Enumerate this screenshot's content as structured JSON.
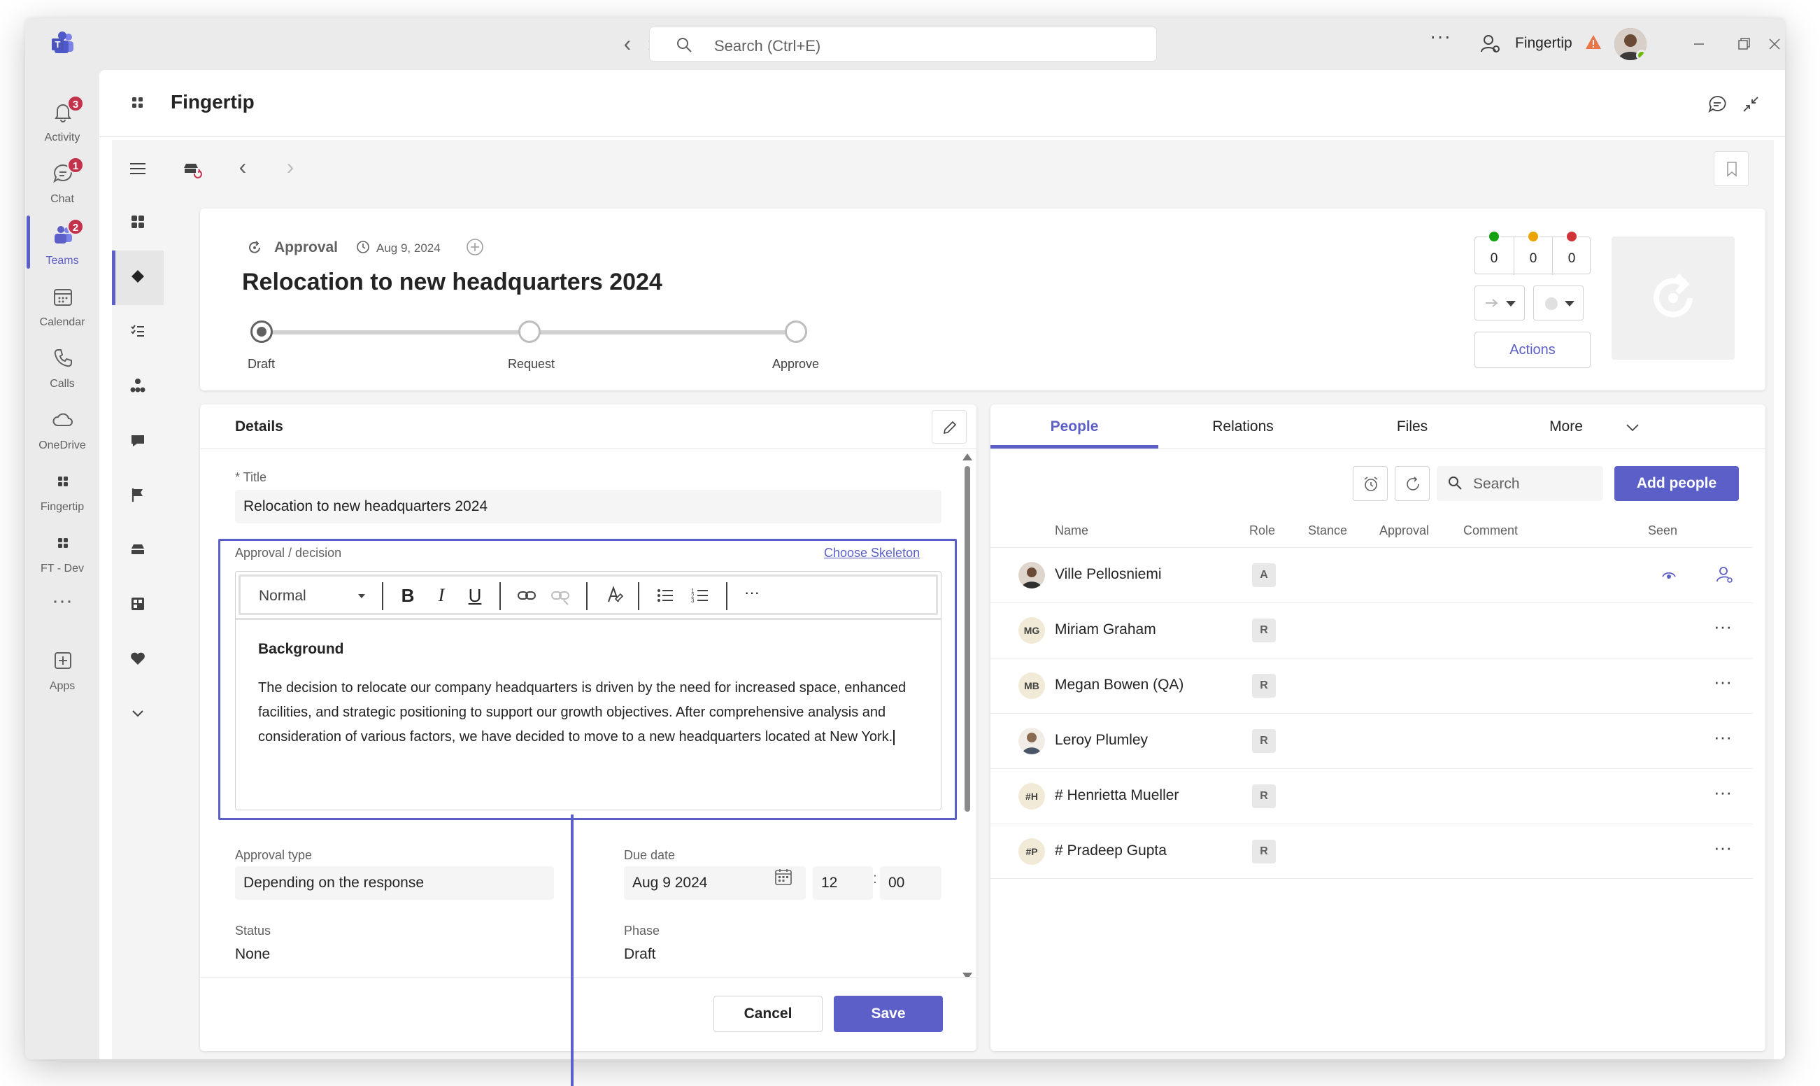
{
  "titlebar": {
    "search_placeholder": "Search (Ctrl+E)",
    "more": "···",
    "org_name": "Fingertip"
  },
  "rail": {
    "items": [
      {
        "label": "Activity",
        "badge": "3",
        "icon": "bell-icon"
      },
      {
        "label": "Chat",
        "badge": "1",
        "icon": "chat-icon"
      },
      {
        "label": "Teams",
        "badge": "2",
        "icon": "teams-icon",
        "active": true
      },
      {
        "label": "Calendar",
        "icon": "calendar-icon"
      },
      {
        "label": "Calls",
        "icon": "phone-icon"
      },
      {
        "label": "OneDrive",
        "icon": "cloud-icon"
      },
      {
        "label": "Fingertip",
        "icon": "app-grid-icon"
      },
      {
        "label": "FT - Dev",
        "icon": "app-grid-icon"
      },
      {
        "label": "Apps",
        "icon": "add-app-icon"
      }
    ],
    "more": "···"
  },
  "app": {
    "title": "Fingertip"
  },
  "record": {
    "type": "Approval",
    "date": "Aug 9, 2024",
    "title": "Relocation to new headquarters 2024",
    "phases": [
      {
        "label": "Draft",
        "current": true
      },
      {
        "label": "Request"
      },
      {
        "label": "Approve"
      }
    ],
    "counters": [
      {
        "value": "0",
        "color": "#13a10e"
      },
      {
        "value": "0",
        "color": "#eaa300"
      },
      {
        "value": "0",
        "color": "#d13438"
      }
    ],
    "actions_label": "Actions"
  },
  "details": {
    "heading": "Details",
    "title_label": "Title",
    "title_required": "*",
    "title_value": "Relocation to new headquarters 2024",
    "decision_label": "Approval / decision",
    "choose_skeleton": "Choose Skeleton",
    "editor": {
      "style": "Normal",
      "more": "···",
      "heading": "Background",
      "paragraph": "The decision to relocate our company headquarters is driven by the need for increased space, enhanced facilities, and strategic positioning to support our growth objectives. After comprehensive analysis and consideration of various factors, we have decided to move to a new headquarters located at New York."
    },
    "approval_type_label": "Approval type",
    "approval_type_value": "Depending on the response",
    "due_date_label": "Due date",
    "due_date_value": "Aug 9 2024",
    "due_hour": "12",
    "due_minute": "00",
    "time_sep": ":",
    "status_label": "Status",
    "status_value": "None",
    "phase_label": "Phase",
    "phase_value": "Draft",
    "cancel_label": "Cancel",
    "save_label": "Save"
  },
  "people": {
    "tabs": [
      {
        "label": "People",
        "active": true
      },
      {
        "label": "Relations"
      },
      {
        "label": "Files"
      },
      {
        "label": "More"
      }
    ],
    "search_placeholder": "Search",
    "add_label": "Add people",
    "columns": [
      "Name",
      "Role",
      "Stance",
      "Approval",
      "Comment",
      "Seen"
    ],
    "rows": [
      {
        "name": "Ville Pellosniemi",
        "initials": "",
        "role": "A",
        "avatar_bg": "#5b3d2e",
        "photo": true,
        "seen": true
      },
      {
        "name": "Miriam Graham",
        "initials": "MG",
        "role": "R",
        "avatar_bg": "#f1ead6"
      },
      {
        "name": "Megan Bowen (QA)",
        "initials": "MB",
        "role": "R",
        "avatar_bg": "#f1ead6"
      },
      {
        "name": "Leroy Plumley",
        "initials": "",
        "role": "R",
        "avatar_bg": "#e8e0d8",
        "photo": true
      },
      {
        "name": "# Henrietta Mueller",
        "initials": "#H",
        "role": "R",
        "avatar_bg": "#f1ead6"
      },
      {
        "name": "# Pradeep Gupta",
        "initials": "#P",
        "role": "R",
        "avatar_bg": "#f1ead6"
      }
    ],
    "row_more": "···"
  },
  "colors": {
    "accent": "#5b5fc7",
    "badge": "#c4314b"
  }
}
